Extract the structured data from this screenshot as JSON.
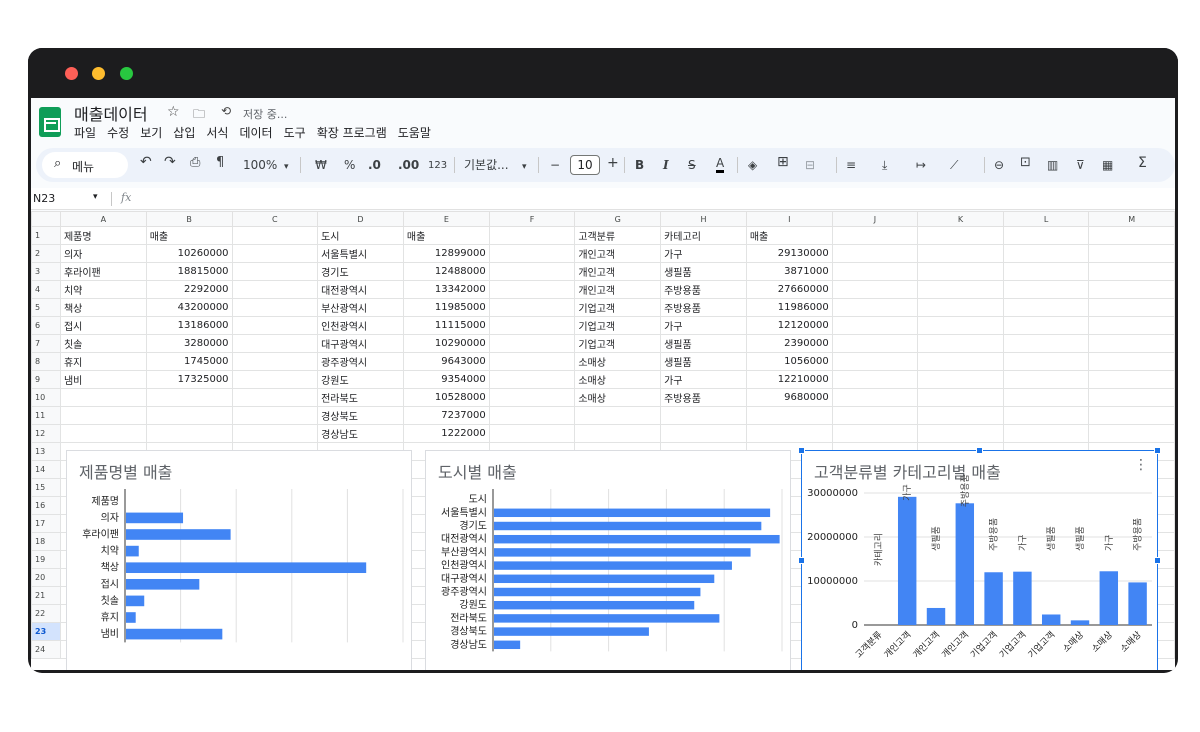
{
  "app": {
    "doc_title": "매출데이터",
    "save_status": "저장 중...",
    "menus": [
      "파일",
      "수정",
      "보기",
      "삽입",
      "서식",
      "데이터",
      "도구",
      "확장 프로그램",
      "도움말"
    ]
  },
  "toolbar": {
    "search": "메뉴",
    "zoom": "100%",
    "currency": "₩",
    "percent": "%",
    "dec_dec": ".0",
    "dec_inc": ".00",
    "number_format": "123",
    "font": "기본값...",
    "font_size": "10",
    "minus": "−",
    "plus": "+",
    "bold": "B",
    "italic": "I",
    "text_color_letter": "A",
    "sum": "Σ"
  },
  "formula_bar": {
    "name_box": "N23",
    "fx": "fx"
  },
  "sheet": {
    "columns": [
      "A",
      "B",
      "C",
      "D",
      "E",
      "F",
      "G",
      "H",
      "I",
      "J",
      "K",
      "L",
      "M"
    ],
    "row_numbers": [
      "1",
      "2",
      "3",
      "4",
      "5",
      "6",
      "7",
      "8",
      "9",
      "10",
      "11",
      "12",
      "13",
      "14",
      "15",
      "16",
      "17",
      "18",
      "19",
      "20",
      "21",
      "22",
      "23",
      "24"
    ],
    "selected_row": "23",
    "rows": [
      [
        "제품명",
        "매출",
        "",
        "도시",
        "매출",
        "",
        "고객분류",
        "카테고리",
        "매출",
        "",
        "",
        "",
        ""
      ],
      [
        "의자",
        "10260000",
        "",
        "서울특별시",
        "12899000",
        "",
        "개인고객",
        "가구",
        "29130000",
        "",
        "",
        "",
        ""
      ],
      [
        "후라이팬",
        "18815000",
        "",
        "경기도",
        "12488000",
        "",
        "개인고객",
        "생필품",
        "3871000",
        "",
        "",
        "",
        ""
      ],
      [
        "치약",
        "2292000",
        "",
        "대전광역시",
        "13342000",
        "",
        "개인고객",
        "주방용품",
        "27660000",
        "",
        "",
        "",
        ""
      ],
      [
        "책상",
        "43200000",
        "",
        "부산광역시",
        "11985000",
        "",
        "기업고객",
        "주방용품",
        "11986000",
        "",
        "",
        "",
        ""
      ],
      [
        "접시",
        "13186000",
        "",
        "인천광역시",
        "11115000",
        "",
        "기업고객",
        "가구",
        "12120000",
        "",
        "",
        "",
        ""
      ],
      [
        "칫솔",
        "3280000",
        "",
        "대구광역시",
        "10290000",
        "",
        "기업고객",
        "생필품",
        "2390000",
        "",
        "",
        "",
        ""
      ],
      [
        "휴지",
        "1745000",
        "",
        "광주광역시",
        "9643000",
        "",
        "소매상",
        "생필품",
        "1056000",
        "",
        "",
        "",
        ""
      ],
      [
        "냄비",
        "17325000",
        "",
        "강원도",
        "9354000",
        "",
        "소매상",
        "가구",
        "12210000",
        "",
        "",
        "",
        ""
      ],
      [
        "",
        "",
        "",
        "전라북도",
        "10528000",
        "",
        "소매상",
        "주방용품",
        "9680000",
        "",
        "",
        "",
        ""
      ],
      [
        "",
        "",
        "",
        "경상북도",
        "7237000",
        "",
        "",
        "",
        "",
        "",
        "",
        "",
        ""
      ],
      [
        "",
        "",
        "",
        "경상남도",
        "1222000",
        "",
        "",
        "",
        "",
        "",
        "",
        "",
        ""
      ],
      [
        "",
        "",
        "",
        "",
        "",
        "",
        "",
        "",
        "",
        "",
        "",
        "",
        ""
      ]
    ]
  },
  "charts": {
    "product": {
      "title": "제품명별 매출",
      "header_label": "제품명"
    },
    "city": {
      "title": "도시별 매출",
      "header_label": "도시"
    },
    "customer": {
      "title": "고객분류별 카테고리별 매출"
    }
  },
  "chart_data": [
    {
      "type": "bar",
      "orientation": "horizontal",
      "title": "제품명별 매출",
      "categories": [
        "의자",
        "후라이팬",
        "치약",
        "책상",
        "접시",
        "칫솔",
        "휴지",
        "냄비"
      ],
      "values": [
        10260000,
        18815000,
        2292000,
        43200000,
        13186000,
        3280000,
        1745000,
        17325000
      ],
      "color": "#4285f4"
    },
    {
      "type": "bar",
      "orientation": "horizontal",
      "title": "도시별 매출",
      "categories": [
        "서울특별시",
        "경기도",
        "대전광역시",
        "부산광역시",
        "인천광역시",
        "대구광역시",
        "광주광역시",
        "강원도",
        "전라북도",
        "경상북도",
        "경상남도"
      ],
      "values": [
        12899000,
        12488000,
        13342000,
        11985000,
        11115000,
        10290000,
        9643000,
        9354000,
        10528000,
        7237000,
        1222000
      ],
      "color": "#4285f4"
    },
    {
      "type": "bar",
      "orientation": "vertical",
      "title": "고객분류별 카테고리별 매출",
      "categories": [
        "고객분류",
        "개인고객",
        "개인고객",
        "개인고객",
        "기업고객",
        "기업고객",
        "기업고객",
        "소매상",
        "소매상",
        "소매상"
      ],
      "bar_labels": [
        "카테고리",
        "가구",
        "생필품",
        "주방용품",
        "주방용품",
        "가구",
        "생필품",
        "생필품",
        "가구",
        "주방용품"
      ],
      "values": [
        0,
        29130000,
        3871000,
        27660000,
        11986000,
        12120000,
        2390000,
        1056000,
        12210000,
        9680000
      ],
      "yticks": [
        "0",
        "10000000",
        "20000000",
        "30000000"
      ],
      "ylim": [
        0,
        30000000
      ],
      "color": "#4285f4"
    }
  ]
}
